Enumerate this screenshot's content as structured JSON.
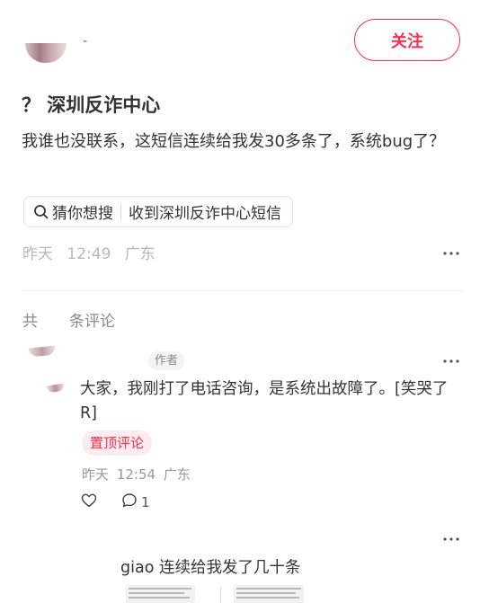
{
  "author": {
    "name": "-",
    "follow_label": "关注"
  },
  "note": {
    "title": "？ 深圳反诈中心",
    "description": "我谁也没联系，这短信连续给我发30多条了，系统bug了？",
    "search_chip": {
      "label": "猜你想搜",
      "query": "收到深圳反诈中心短信"
    },
    "date": "昨天",
    "time": "12:49",
    "location": "广东"
  },
  "comments_header": {
    "prefix": "共",
    "suffix": "条评论"
  },
  "comments": [
    {
      "badge": "作者",
      "text": "大家，我刚打了电话咨询，是系统出故障了。[笑哭了R]",
      "pinned_label": "置顶评论",
      "date": "昨天",
      "time": "12:54",
      "location": "广东",
      "reply_count": "1"
    },
    {
      "text": "giao 连续给我发了几十条"
    }
  ],
  "colors": {
    "accent": "#ff2e4d",
    "pin_bg": "#fdecef",
    "meta": "#b8b8b8"
  },
  "icons": {
    "search": "search-icon",
    "more": "more-icon",
    "like": "heart-icon",
    "reply": "comment-bubble-icon"
  }
}
